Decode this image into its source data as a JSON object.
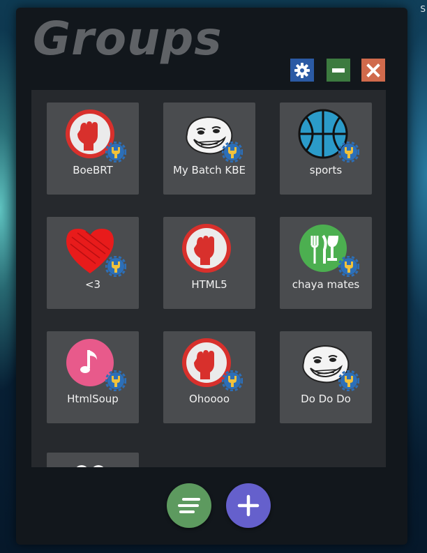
{
  "window": {
    "title": "Groups",
    "corner_text": "S"
  },
  "controls": {
    "settings_icon": "gear-icon",
    "minimize_icon": "minus-icon",
    "close_icon": "close-icon"
  },
  "groups": [
    {
      "name": "BoeBRT",
      "icon": "raised-fist-icon",
      "badge": "admin-badge-icon"
    },
    {
      "name": "My Batch KBE",
      "icon": "trollface-icon",
      "badge": "admin-badge-icon"
    },
    {
      "name": "sports",
      "icon": "basketball-icon",
      "badge": "admin-badge-icon"
    },
    {
      "name": "<3",
      "icon": "heart-icon",
      "badge": "admin-badge-icon"
    },
    {
      "name": "HTML5",
      "icon": "raised-fist-icon",
      "badge": "admin-badge-icon"
    },
    {
      "name": "chaya mates",
      "icon": "fork-knife-glass-icon",
      "badge": "admin-badge-icon"
    },
    {
      "name": "HtmlSoup",
      "icon": "music-note-icon",
      "badge": "admin-badge-icon"
    },
    {
      "name": "Ohoooo",
      "icon": "raised-fist-icon",
      "badge": "admin-badge-icon"
    },
    {
      "name": "Do Do Do",
      "icon": "trollface-icon",
      "badge": "admin-badge-icon"
    },
    {
      "name": "",
      "icon": "people-icon",
      "badge": ""
    }
  ],
  "actions": {
    "menu_icon": "menu-lines-icon",
    "add_icon": "plus-icon"
  },
  "colors": {
    "settings": "#2b5aa4",
    "minimize": "#3c7a3f",
    "close": "#d06a4c",
    "menu_fab": "#5d9a5f",
    "add_fab": "#6560cc",
    "tile": "#4a4c4f"
  }
}
